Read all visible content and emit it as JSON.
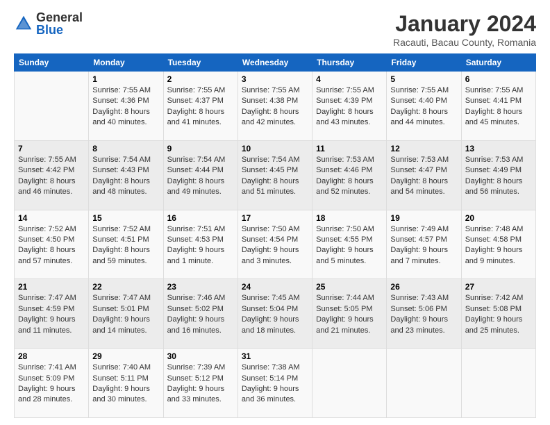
{
  "logo": {
    "general": "General",
    "blue": "Blue"
  },
  "title": "January 2024",
  "subtitle": "Racauti, Bacau County, Romania",
  "days_header": [
    "Sunday",
    "Monday",
    "Tuesday",
    "Wednesday",
    "Thursday",
    "Friday",
    "Saturday"
  ],
  "weeks": [
    [
      {
        "num": "",
        "info": ""
      },
      {
        "num": "1",
        "info": "Sunrise: 7:55 AM\nSunset: 4:36 PM\nDaylight: 8 hours\nand 40 minutes."
      },
      {
        "num": "2",
        "info": "Sunrise: 7:55 AM\nSunset: 4:37 PM\nDaylight: 8 hours\nand 41 minutes."
      },
      {
        "num": "3",
        "info": "Sunrise: 7:55 AM\nSunset: 4:38 PM\nDaylight: 8 hours\nand 42 minutes."
      },
      {
        "num": "4",
        "info": "Sunrise: 7:55 AM\nSunset: 4:39 PM\nDaylight: 8 hours\nand 43 minutes."
      },
      {
        "num": "5",
        "info": "Sunrise: 7:55 AM\nSunset: 4:40 PM\nDaylight: 8 hours\nand 44 minutes."
      },
      {
        "num": "6",
        "info": "Sunrise: 7:55 AM\nSunset: 4:41 PM\nDaylight: 8 hours\nand 45 minutes."
      }
    ],
    [
      {
        "num": "7",
        "info": "Sunrise: 7:55 AM\nSunset: 4:42 PM\nDaylight: 8 hours\nand 46 minutes."
      },
      {
        "num": "8",
        "info": "Sunrise: 7:54 AM\nSunset: 4:43 PM\nDaylight: 8 hours\nand 48 minutes."
      },
      {
        "num": "9",
        "info": "Sunrise: 7:54 AM\nSunset: 4:44 PM\nDaylight: 8 hours\nand 49 minutes."
      },
      {
        "num": "10",
        "info": "Sunrise: 7:54 AM\nSunset: 4:45 PM\nDaylight: 8 hours\nand 51 minutes."
      },
      {
        "num": "11",
        "info": "Sunrise: 7:53 AM\nSunset: 4:46 PM\nDaylight: 8 hours\nand 52 minutes."
      },
      {
        "num": "12",
        "info": "Sunrise: 7:53 AM\nSunset: 4:47 PM\nDaylight: 8 hours\nand 54 minutes."
      },
      {
        "num": "13",
        "info": "Sunrise: 7:53 AM\nSunset: 4:49 PM\nDaylight: 8 hours\nand 56 minutes."
      }
    ],
    [
      {
        "num": "14",
        "info": "Sunrise: 7:52 AM\nSunset: 4:50 PM\nDaylight: 8 hours\nand 57 minutes."
      },
      {
        "num": "15",
        "info": "Sunrise: 7:52 AM\nSunset: 4:51 PM\nDaylight: 8 hours\nand 59 minutes."
      },
      {
        "num": "16",
        "info": "Sunrise: 7:51 AM\nSunset: 4:53 PM\nDaylight: 9 hours\nand 1 minute."
      },
      {
        "num": "17",
        "info": "Sunrise: 7:50 AM\nSunset: 4:54 PM\nDaylight: 9 hours\nand 3 minutes."
      },
      {
        "num": "18",
        "info": "Sunrise: 7:50 AM\nSunset: 4:55 PM\nDaylight: 9 hours\nand 5 minutes."
      },
      {
        "num": "19",
        "info": "Sunrise: 7:49 AM\nSunset: 4:57 PM\nDaylight: 9 hours\nand 7 minutes."
      },
      {
        "num": "20",
        "info": "Sunrise: 7:48 AM\nSunset: 4:58 PM\nDaylight: 9 hours\nand 9 minutes."
      }
    ],
    [
      {
        "num": "21",
        "info": "Sunrise: 7:47 AM\nSunset: 4:59 PM\nDaylight: 9 hours\nand 11 minutes."
      },
      {
        "num": "22",
        "info": "Sunrise: 7:47 AM\nSunset: 5:01 PM\nDaylight: 9 hours\nand 14 minutes."
      },
      {
        "num": "23",
        "info": "Sunrise: 7:46 AM\nSunset: 5:02 PM\nDaylight: 9 hours\nand 16 minutes."
      },
      {
        "num": "24",
        "info": "Sunrise: 7:45 AM\nSunset: 5:04 PM\nDaylight: 9 hours\nand 18 minutes."
      },
      {
        "num": "25",
        "info": "Sunrise: 7:44 AM\nSunset: 5:05 PM\nDaylight: 9 hours\nand 21 minutes."
      },
      {
        "num": "26",
        "info": "Sunrise: 7:43 AM\nSunset: 5:06 PM\nDaylight: 9 hours\nand 23 minutes."
      },
      {
        "num": "27",
        "info": "Sunrise: 7:42 AM\nSunset: 5:08 PM\nDaylight: 9 hours\nand 25 minutes."
      }
    ],
    [
      {
        "num": "28",
        "info": "Sunrise: 7:41 AM\nSunset: 5:09 PM\nDaylight: 9 hours\nand 28 minutes."
      },
      {
        "num": "29",
        "info": "Sunrise: 7:40 AM\nSunset: 5:11 PM\nDaylight: 9 hours\nand 30 minutes."
      },
      {
        "num": "30",
        "info": "Sunrise: 7:39 AM\nSunset: 5:12 PM\nDaylight: 9 hours\nand 33 minutes."
      },
      {
        "num": "31",
        "info": "Sunrise: 7:38 AM\nSunset: 5:14 PM\nDaylight: 9 hours\nand 36 minutes."
      },
      {
        "num": "",
        "info": ""
      },
      {
        "num": "",
        "info": ""
      },
      {
        "num": "",
        "info": ""
      }
    ]
  ]
}
